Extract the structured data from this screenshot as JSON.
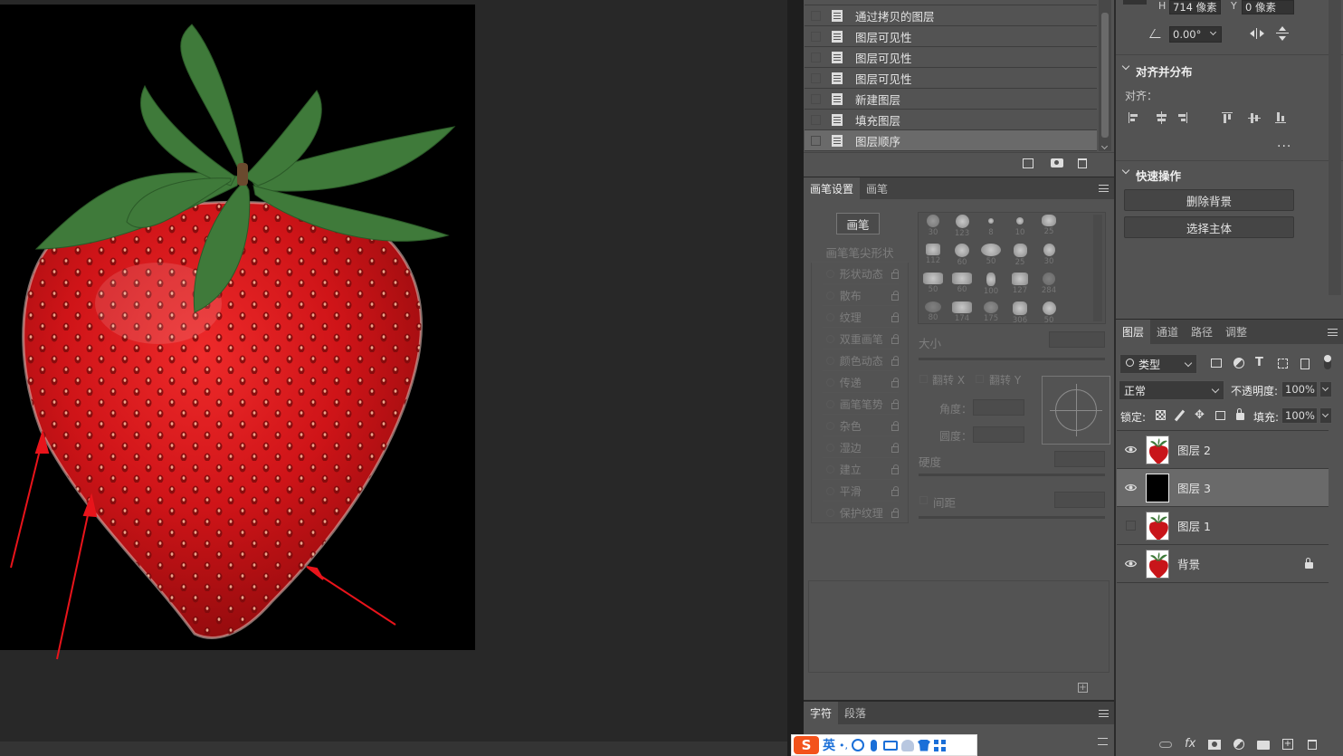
{
  "history": {
    "items": [
      {
        "label": "通过拷贝的图层"
      },
      {
        "label": "图层可见性"
      },
      {
        "label": "图层可见性"
      },
      {
        "label": "图层可见性"
      },
      {
        "label": "新建图层"
      },
      {
        "label": "填充图层"
      },
      {
        "label": "图层顺序",
        "selected": true
      }
    ]
  },
  "transform": {
    "h_label": "H",
    "h_value": "714 像素",
    "y_label": "Y",
    "y_value": "0 像素",
    "angle_value": "0.00°"
  },
  "align": {
    "section_title": "对齐并分布",
    "align_label": "对齐：",
    "more_label": "..."
  },
  "quick_actions": {
    "section_title": "快速操作",
    "remove_bg": "删除背景",
    "select_subject": "选择主体"
  },
  "brush_panel": {
    "tabs": [
      "画笔设置",
      "画笔"
    ],
    "brush_button": "画笔",
    "tip_shape_label": "画笔笔尖形状",
    "options": [
      "形状动态",
      "散布",
      "纹理",
      "双重画笔",
      "颜色动态",
      "传递",
      "画笔笔势",
      "杂色",
      "湿边",
      "建立",
      "平滑",
      "保护纹理"
    ],
    "brush_sizes": [
      "30",
      "123",
      "8",
      "10",
      "25",
      "112",
      "60",
      "50",
      "25",
      "30",
      "50",
      "60",
      "100",
      "127",
      "284",
      "80",
      "174",
      "175",
      "306",
      "50"
    ],
    "size_label": "大小",
    "flip_x": "翻转 X",
    "flip_y": "翻转 Y",
    "angle_label": "角度：",
    "roundness_label": "圆度：",
    "hardness_label": "硬度",
    "spacing_label": "间距"
  },
  "char_panel": {
    "tabs": [
      "字符",
      "段落"
    ]
  },
  "layers_panel": {
    "tabs": [
      "图层",
      "通道",
      "路径",
      "调整"
    ],
    "filter_kind": "类型",
    "blend_mode": "正常",
    "opacity_label": "不透明度:",
    "opacity_value": "100%",
    "lock_label": "锁定:",
    "fill_label": "填充:",
    "fill_value": "100%",
    "layers": [
      {
        "name": "图层 2",
        "visible": true,
        "thumb": "strawberry",
        "selected": false,
        "locked": false
      },
      {
        "name": "图层 3",
        "visible": true,
        "thumb": "black",
        "selected": true,
        "locked": false
      },
      {
        "name": "图层 1",
        "visible": false,
        "thumb": "strawberry",
        "selected": false,
        "locked": false
      },
      {
        "name": "背景",
        "visible": true,
        "thumb": "strawberry",
        "selected": false,
        "locked": true
      }
    ]
  },
  "ime": {
    "lang_label": "英",
    "punct_label": "•,"
  },
  "colors": {
    "accent_red": "#e8141b",
    "strawberry": "#c8151a",
    "leaf": "#3f7a3a"
  }
}
